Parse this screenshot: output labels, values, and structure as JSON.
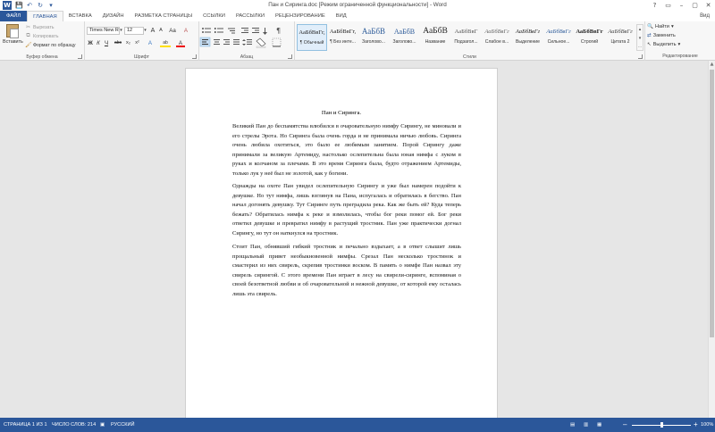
{
  "window": {
    "title": "Пан и Сиринга.doc [Режим ограниченной функциональности] - Word",
    "controls": [
      "?",
      "▭",
      "–",
      "▢",
      "✕"
    ]
  },
  "qat": {
    "app_icon": "W",
    "save": "💾",
    "undo": "↶",
    "redo": "↻",
    "customize": "▾"
  },
  "tabs": [
    {
      "label": "ФАЙЛ"
    },
    {
      "label": "ГЛАВНАЯ"
    },
    {
      "label": "ВСТАВКА"
    },
    {
      "label": "ДИЗАЙН"
    },
    {
      "label": "РАЗМЕТКА СТРАНИЦЫ"
    },
    {
      "label": "ССЫЛКИ"
    },
    {
      "label": "РАССЫЛКИ"
    },
    {
      "label": "РЕЦЕНЗИРОВАНИЕ"
    },
    {
      "label": "ВИД"
    }
  ],
  "user": "Вид",
  "clipboard": {
    "paste": "Вставить",
    "cut": "Вырезать",
    "copy": "Копировать",
    "format_painter": "Формат по образцу",
    "group_label": "Буфер обмена"
  },
  "font": {
    "name": "Times New R",
    "size": "12",
    "grow": "A",
    "shrink": "A",
    "case": "Aa",
    "clear": "A",
    "bold": "Ж",
    "italic": "К",
    "underline": "Ч",
    "strike": "abc",
    "sub": "x₂",
    "sup": "x²",
    "effects": "A",
    "highlight": "ab",
    "color": "A",
    "group_label": "Шрифт"
  },
  "paragraph": {
    "group_label": "Абзац"
  },
  "styles": {
    "group_label": "Стили",
    "items": [
      {
        "sample": "АаБбВвГг,",
        "name": "¶ Обычный"
      },
      {
        "sample": "АаБбВвГг,",
        "name": "¶ Без инте..."
      },
      {
        "sample": "АаБбВ",
        "name": "Заголово..."
      },
      {
        "sample": "АаБбВ",
        "name": "Заголово..."
      },
      {
        "sample": "АаБбВ",
        "name": "Название"
      },
      {
        "sample": "АаБбВвГ",
        "name": "Подзагол..."
      },
      {
        "sample": "АаБбВвГг",
        "name": "Слабое в..."
      },
      {
        "sample": "АаБбВвГг",
        "name": "Выделение"
      },
      {
        "sample": "АаБбВвГг",
        "name": "Сильное..."
      },
      {
        "sample": "АаБбВвГг",
        "name": "Строгий"
      },
      {
        "sample": "АаБбВвГг",
        "name": "Цитата 2"
      }
    ]
  },
  "editing": {
    "find": "Найти",
    "replace": "Заменить",
    "select": "Выделить",
    "group_label": "Редактирование"
  },
  "document": {
    "title": "Пан и Сиринга.",
    "paragraphs": [
      [
        "Великий Пан до беспамятства влюбился в очаровательную нимфу Сирингу, не миновали и",
        "его стрелы Эрота. Но Сиринга была очень горда и не принимала ничью любовь. Сиринга",
        "очень любила охотиться, это было ее любимым занятием. Порой Сирингу даже",
        "принимали за великую Артемиду, настолько ослепительна была юная нимфа с луком в",
        "руках и колчаном за плечами. В это время Сиринга была, будто отражением Артемиды,",
        "только лук у неё был не золотой, как у богини."
      ],
      [
        "Однажды на охоте Пан увидел ослепительную Сирингу и уже был намерен подойти к",
        "девушке. Но тут нимфа, лишь взглянув на Пана, испугалась и обратилась в бегство. Пан",
        "начал догонять девушку. Тут Сиринге путь преградила река. Как же быть ей? Куда теперь",
        "бежать? Обратилась нимфа к реке и взмолилась, чтобы бог реки помог ей. Бог реки",
        "ответил девушке и превратил нимфу в растущий тростник. Пан уже практически догнал",
        "Сирингу, но тут он наткнулся на тростник."
      ],
      [
        "Стоит Пан, обнявший гибкий тростник и печально вздыхает, а в ответ слышит лишь",
        "прощальный привет необыкновенной нимфы. Срезал Пан несколько тростинок и",
        "смастерил из них свирель, скрепив тростинки воском. В память о нимфе Пан назвал эту",
        "свирель сирингой. С этого времени Пан играет в лесу на свирели-сиринге, вспоминая о",
        "своей безответной любви и об очаровательной и нежной девушке, от которой ему осталась",
        "лишь эта свирель."
      ]
    ]
  },
  "status": {
    "page": "СТРАНИЦА 1 ИЗ 1",
    "words": "ЧИСЛО СЛОВ: 214",
    "language": "РУССКИЙ",
    "zoom_out": "–",
    "zoom_in": "+",
    "zoom": "100%",
    "zoom_level": 1.0
  }
}
